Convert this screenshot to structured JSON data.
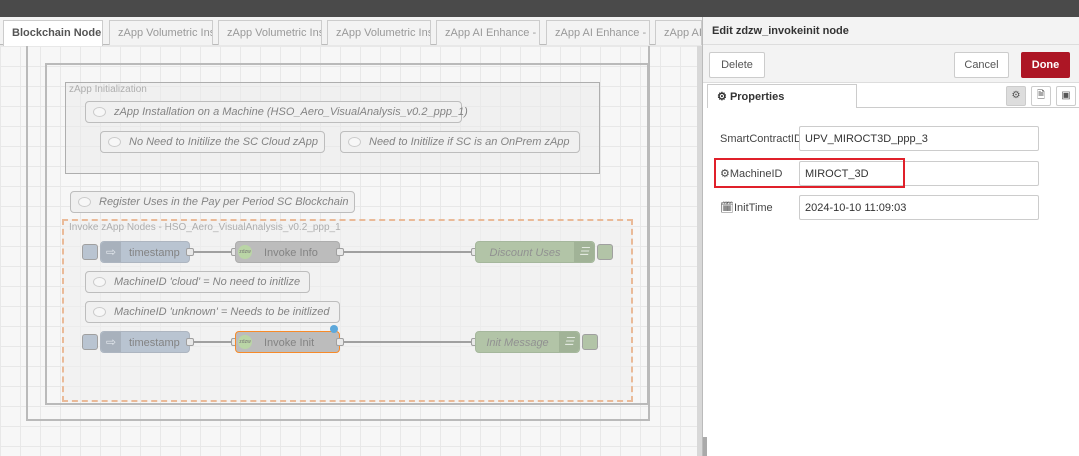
{
  "workspace": {
    "tabs": [
      "Blockchain Node I",
      "zApp Volumetric Ins",
      "zApp Volumetric Ins",
      "zApp Volumetric Ins",
      "zApp AI Enhance -",
      "zApp AI Enhance -",
      "zApp AI"
    ],
    "groups": {
      "init": "zApp Initialization",
      "invoke": "Invoke zApp Nodes - HSO_Aero_VisualAnalysis_v0.2_ppp_1"
    },
    "comments": {
      "install": "zApp Installation on a Machine (HSO_Aero_VisualAnalysis_v0.2_ppp_1)",
      "no_need": "No Need to Initilize the SC Cloud zApp",
      "need": "Need to Initilize if SC is an OnPrem zApp",
      "register": "Register Uses in the Pay per Period SC Blockchain",
      "cloud": "MachineID 'cloud' = No need to initlize",
      "unknown": "MachineID 'unknown' = Needs to be initlized"
    },
    "nodes": {
      "timestamp1": "timestamp",
      "invoke_info": "Invoke Info",
      "discount": "Discount Uses",
      "timestamp2": "timestamp",
      "invoke_init": "Invoke Init",
      "init_msg": "Init Message"
    },
    "zlogo": "zdzw"
  },
  "tray": {
    "title": "Edit zdzw_invokeinit node",
    "delete": "Delete",
    "cancel": "Cancel",
    "done": "Done",
    "properties_tab": "Properties",
    "fields": {
      "smart_contract_label": "SmartContractID",
      "smart_contract_value": "UPV_MIROCT3D_ppp_3",
      "machine_label": "MachineID",
      "machine_value": "MIROCT_3D",
      "init_time_label": "InitTime",
      "init_time_value": "2024-10-10 11:09:03"
    }
  },
  "colors": {
    "done_button": "#ad1625",
    "highlight": "#e0202a",
    "selected_node": "#ff7f0e"
  }
}
